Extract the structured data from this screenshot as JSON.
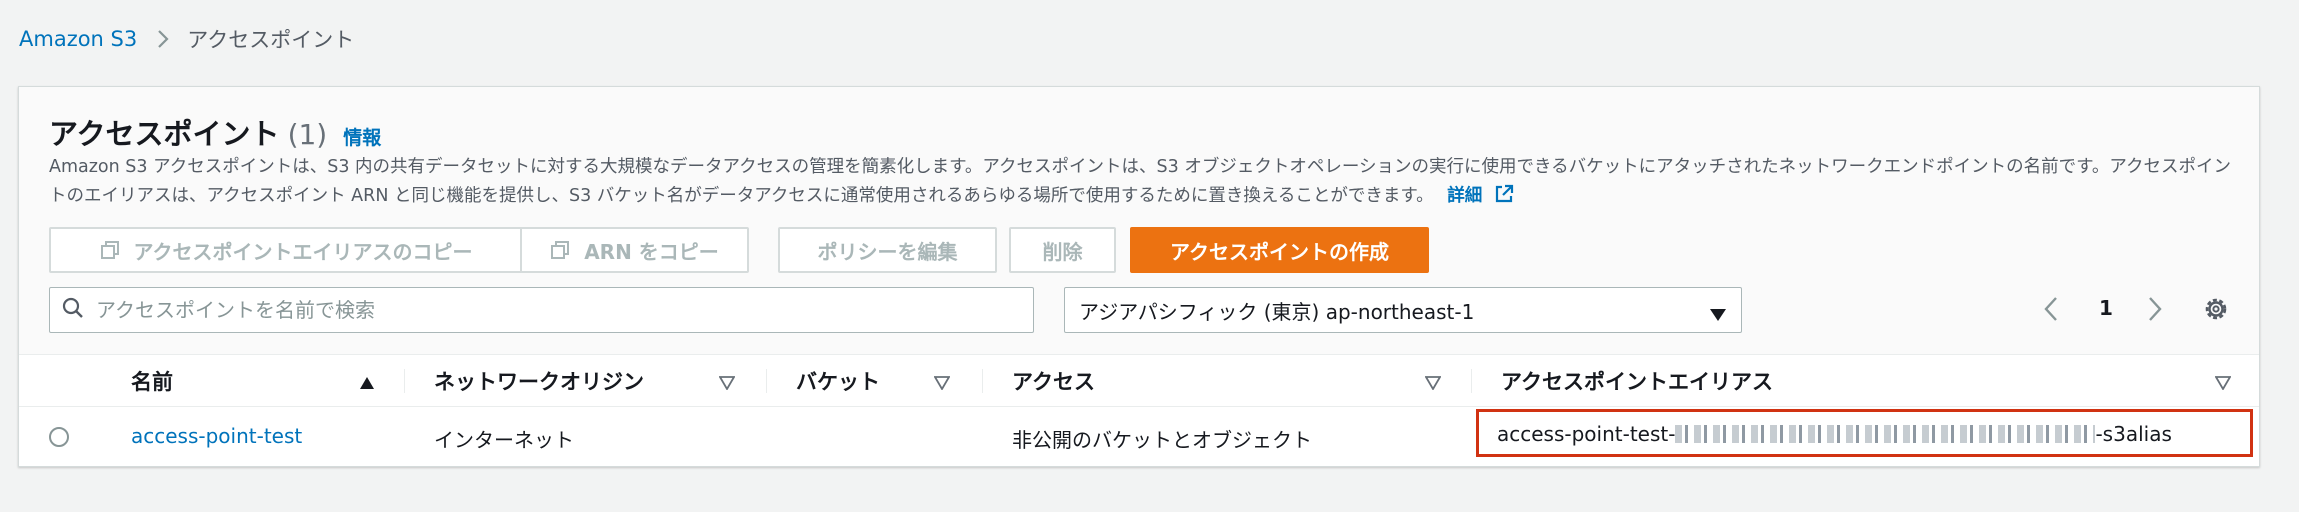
{
  "breadcrumb": {
    "root": "Amazon S3",
    "current": "アクセスポイント"
  },
  "panel": {
    "title": "アクセスポイント",
    "count": "(1)",
    "info": "情報",
    "description": "Amazon S3 アクセスポイントは、S3 内の共有データセットに対する大規模なデータアクセスの管理を簡素化します。アクセスポイントは、S3 オブジェクトオペレーションの実行に使用できるバケットにアタッチされたネットワークエンドポイントの名前です。アクセスポイントのエイリアスは、アクセスポイント ARN と同じ機能を提供し、S3 バケット名がデータアクセスに通常使用されるあらゆる場所で使用するために置き換えることができます。",
    "learn_more": "詳細"
  },
  "actions": {
    "copy_alias": "アクセスポイントエイリアスのコピー",
    "copy_arn": "ARN をコピー",
    "edit_policy": "ポリシーを編集",
    "delete": "削除",
    "create": "アクセスポイントの作成"
  },
  "search": {
    "placeholder": "アクセスポイントを名前で検索"
  },
  "region": {
    "selected": "アジアパシフィック (東京) ap-northeast-1"
  },
  "pagination": {
    "page": "1"
  },
  "table": {
    "columns": [
      "名前",
      "ネットワークオリジン",
      "バケット",
      "アクセス",
      "アクセスポイントエイリアス"
    ],
    "rows": [
      {
        "name": "access-point-test",
        "network_origin": "インターネット",
        "bucket": "",
        "access": "非公開のバケットとオブジェクト",
        "alias_prefix": "access-point-test-",
        "alias_suffix": "-s3alias"
      }
    ]
  },
  "colors": {
    "link": "#0073bb",
    "primary": "#ec7211",
    "highlight": "#d13212"
  }
}
